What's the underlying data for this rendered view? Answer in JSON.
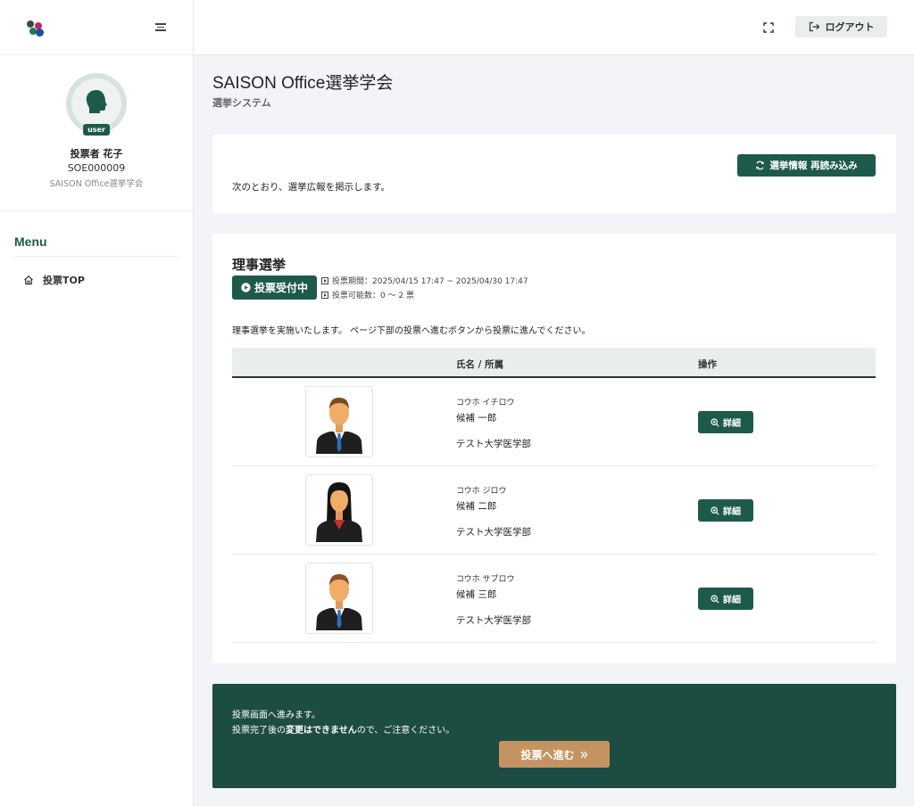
{
  "sidebar": {
    "profile": {
      "badge": "user",
      "name": "投票者 花子",
      "id": "SOE000009",
      "org": "SAISON Office選挙学会"
    },
    "menu_title": "Menu",
    "items": [
      {
        "label": "投票TOP",
        "icon": "home-icon"
      }
    ]
  },
  "topbar": {
    "logout_label": "ログアウト",
    "fullscreen_icon": "fullscreen-icon"
  },
  "page": {
    "title": "SAISON Office選挙学会",
    "subtitle": "選挙システム"
  },
  "info_card": {
    "reload_label": "選挙情報 再読み込み",
    "notice": "次のとおり、選挙広報を掲示します。"
  },
  "election": {
    "title": "理事選挙",
    "status": "投票受付中",
    "period": "投票期間：2025/04/15 17:47 ~ 2025/04/30 17:47",
    "vote_count": "投票可能数：0 ～ 2 票",
    "description": "理事選挙を実施いたします。 ページ下部の投票へ進むボタンから投票に進んでください。",
    "columns": {
      "name": "氏名 / 所属",
      "action": "操作"
    },
    "detail_label": "詳細",
    "candidates": [
      {
        "kana": "コウホ イチロウ",
        "name": "候補 一郎",
        "affiliation": "テスト大学医学部",
        "gender": "male"
      },
      {
        "kana": "コウホ ジロウ",
        "name": "候補 二郎",
        "affiliation": "テスト大学医学部",
        "gender": "female"
      },
      {
        "kana": "コウホ サブロウ",
        "name": "候補 三郎",
        "affiliation": "テスト大学医学部",
        "gender": "male"
      }
    ]
  },
  "footer_card": {
    "line1": "投票画面へ進みます。",
    "line2_pre": "投票完了後の",
    "line2_bold": "変更はできません",
    "line2_post": "ので、ご注意ください。",
    "proceed_label": "投票へ進む"
  },
  "colors": {
    "primary": "#1e5a4b",
    "footer_bg": "#1d4d42",
    "accent": "#c59361"
  }
}
